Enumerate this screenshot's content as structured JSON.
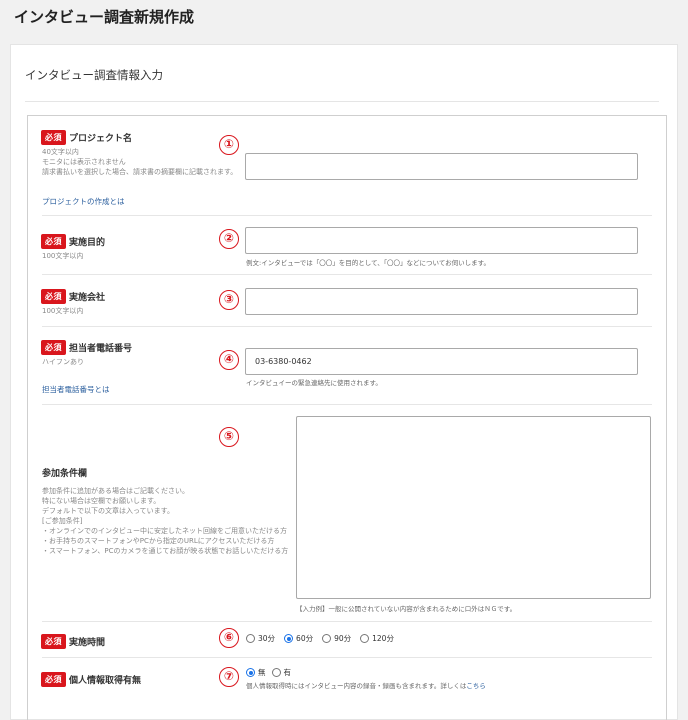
{
  "page": {
    "title": "インタビュー調査新規作成"
  },
  "section": {
    "title": "インタビュー調査情報入力"
  },
  "required_label": "必須",
  "fields": {
    "project_name": {
      "num": "①",
      "label": "プロジェクト名",
      "desc": [
        "40文字以内",
        "モニタには表示されません",
        "請求書払いを選択した場合、請求書の摘要欄に記載されます。"
      ],
      "link": "プロジェクトの作成とは",
      "value": ""
    },
    "purpose": {
      "num": "②",
      "label": "実施目的",
      "desc": "100文字以内",
      "value": "",
      "note": "例文:インタビューでは「〇〇」を目的として、「〇〇」などについてお伺いします。"
    },
    "company": {
      "num": "③",
      "label": "実施会社",
      "desc": "100文字以内",
      "value": ""
    },
    "phone": {
      "num": "④",
      "label": "担当者電話番号",
      "desc": "ハイフンあり",
      "link": "担当者電話番号とは",
      "value": "03-6380-0462",
      "note": "インタビュイーの緊急連絡先に使用されます。"
    },
    "conditions": {
      "num": "⑤",
      "label": "参加条件欄",
      "desc": [
        "参加条件に追加がある場合はご記載ください。",
        "特にない場合は空欄でお願いします。",
        "デフォルトで以下の文章は入っています。",
        "[ご参加条件]",
        "・オンラインでのインタビュー中に安定したネット回線をご用意いただける方",
        "・お手持ちのスマートフォンやPCから指定のURLにアクセスいただける方",
        "・スマートフォン、PCのカメラを通じてお顔が映る状態でお話しいただける方"
      ],
      "value": "",
      "note": "【入力例】一般に公開されていない内容が含まれるために口外はＮＧです。"
    },
    "duration": {
      "num": "⑥",
      "label": "実施時間",
      "options": [
        "30分",
        "60分",
        "90分",
        "120分"
      ],
      "selected": "60分"
    },
    "personal_info": {
      "num": "⑦",
      "label": "個人情報取得有無",
      "options": [
        "無",
        "有"
      ],
      "selected": "無",
      "note": "個人情報取得時にはインタビュー内容の録音・録画も含まれます。詳しくは",
      "note_link": "こちら"
    }
  }
}
